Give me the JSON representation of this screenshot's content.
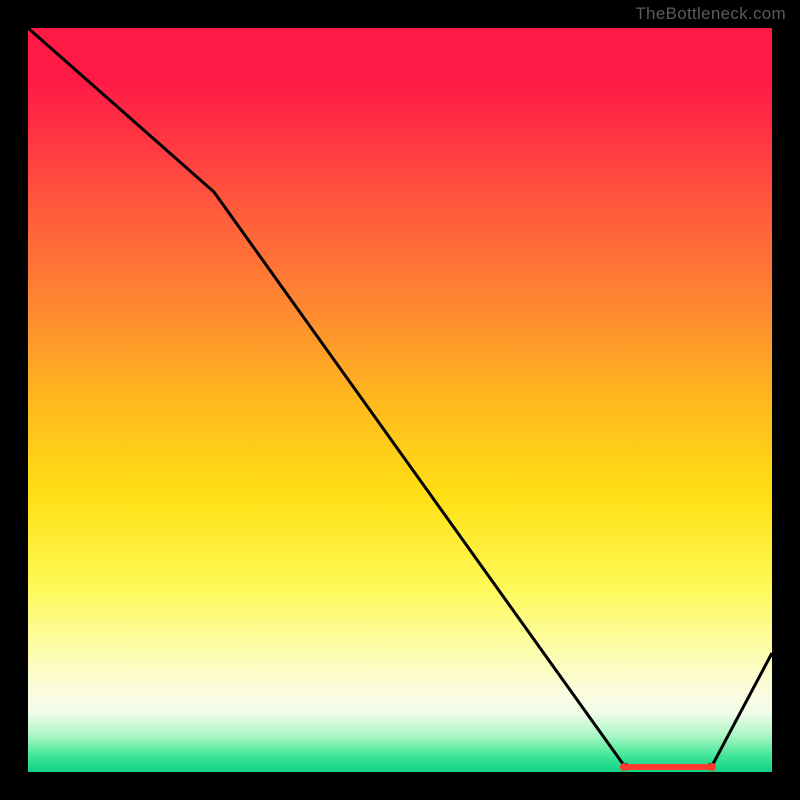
{
  "attribution": "TheBottleneck.com",
  "chart_data": {
    "type": "line",
    "title": "",
    "xlabel": "",
    "ylabel": "",
    "xlim": [
      0,
      100
    ],
    "ylim": [
      0,
      100
    ],
    "x": [
      0,
      25,
      80,
      82,
      90,
      92,
      100
    ],
    "values": [
      100,
      78,
      1,
      0.5,
      0.5,
      1,
      16
    ],
    "grid": false,
    "legend": false,
    "note": "Black curve drawn over a vertical red→yellow→green heat gradient. No visible axes, ticks, or legend. Values are estimates from pixel position; the flat minimum is a thickened red segment near x≈82–92."
  }
}
